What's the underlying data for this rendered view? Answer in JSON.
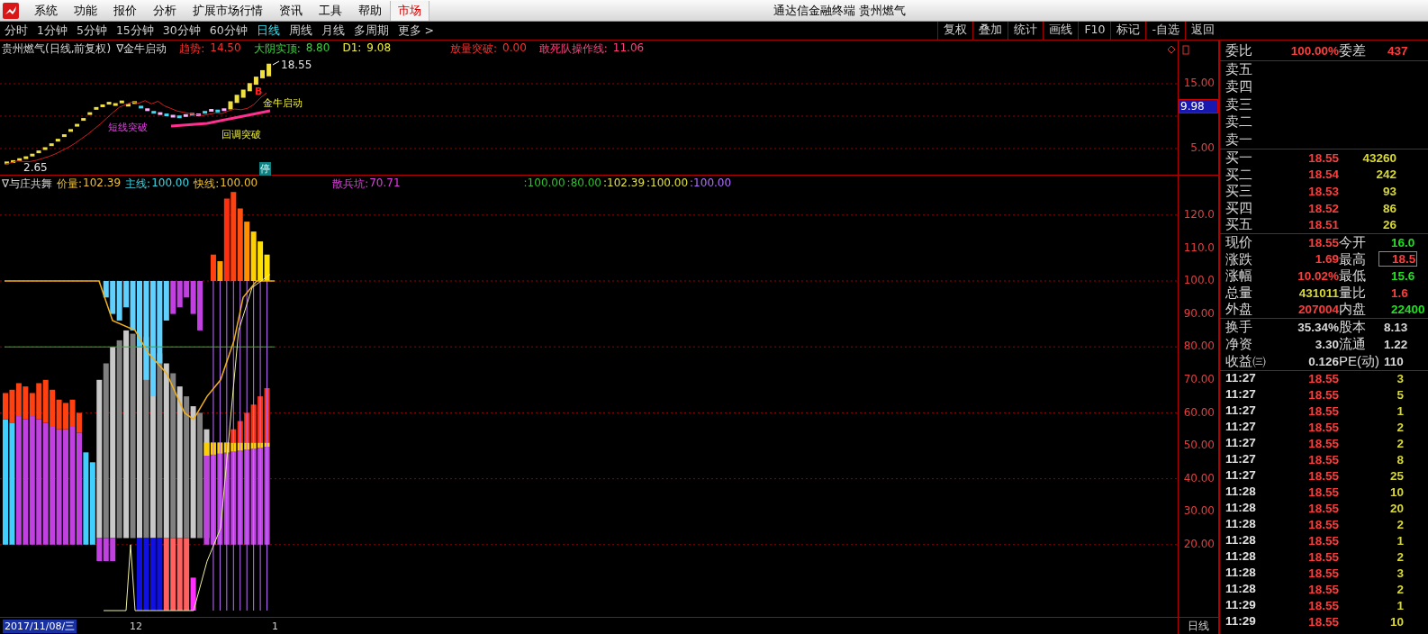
{
  "window": {
    "title": "通达信金融终端 贵州燃气"
  },
  "menu": [
    {
      "label": "系统"
    },
    {
      "label": "功能"
    },
    {
      "label": "报价"
    },
    {
      "label": "分析"
    },
    {
      "label": "扩展市场行情"
    },
    {
      "label": "资讯"
    },
    {
      "label": "工具"
    },
    {
      "label": "帮助"
    }
  ],
  "market_button": "市场",
  "periods": [
    {
      "label": "分时",
      "selected": false
    },
    {
      "label": "1分钟",
      "selected": false
    },
    {
      "label": "5分钟",
      "selected": false
    },
    {
      "label": "15分钟",
      "selected": false
    },
    {
      "label": "30分钟",
      "selected": false
    },
    {
      "label": "60分钟",
      "selected": false
    },
    {
      "label": "日线",
      "selected": true
    },
    {
      "label": "周线",
      "selected": false
    },
    {
      "label": "月线",
      "selected": false
    },
    {
      "label": "多周期",
      "selected": false
    },
    {
      "label": "更多 >",
      "selected": false
    }
  ],
  "tools": [
    "复权",
    "叠加",
    "统计",
    "画线",
    "F10",
    "标记",
    "-自选",
    "返回"
  ],
  "main_chart": {
    "stock": "贵州燃气(日线,前复权)",
    "indicator": "∇金牛启动",
    "values": [
      {
        "label": "趋势:",
        "value": "14.50",
        "color": "#ff3030"
      },
      {
        "label": "大阴实顶:",
        "value": "8.80",
        "color": "#40d040"
      },
      {
        "label": "D1:",
        "value": "9.08",
        "color": "#f0f040"
      },
      {
        "label": "放量突破:",
        "value": "0.00",
        "color": "#ff3030"
      },
      {
        "label": "敢死队操作线:",
        "value": "11.06",
        "color": "#ff4080"
      }
    ],
    "high_label": "18.55",
    "low_label": "2.65",
    "signals": [
      "短线突破",
      "金牛启动",
      "回调突破"
    ],
    "buy_mark": "B",
    "limit_mark": "停",
    "axis": [
      "15.00",
      "5.00"
    ],
    "price_tag": "9.98"
  },
  "sub_chart": {
    "indicator": "∇与庄共舞",
    "values": [
      {
        "label": "价量:",
        "value": "102.39",
        "color": "#f0c030"
      },
      {
        "label": "主线:",
        "value": "100.00",
        "color": "#40d8e8"
      },
      {
        "label": "快线:",
        "value": "100.00",
        "color": "#f0c030"
      },
      {
        "label": "散兵坑:",
        "value": "70.71",
        "color": "#e040e0"
      }
    ],
    "outputs": [
      {
        "text": ":100.00",
        "color": "#30c030"
      },
      {
        "text": ":80.00",
        "color": "#30c030"
      },
      {
        "text": ":102.39",
        "color": "#e0e040"
      },
      {
        "text": ":100.00",
        "color": "#e0e040"
      },
      {
        "text": ":100.00",
        "color": "#b070ff"
      }
    ],
    "axis": [
      "120.0",
      "110.0",
      "100.0",
      "90.00",
      "80.00",
      "70.00",
      "60.00",
      "50.00",
      "40.00",
      "30.00",
      "20.00"
    ]
  },
  "date_axis": [
    {
      "label": "2017/11/08/三",
      "selected": true
    },
    {
      "label": "12",
      "selected": false
    },
    {
      "label": "1",
      "selected": false
    }
  ],
  "period_corner": "日线",
  "quote": {
    "ratio": [
      {
        "label": "委比",
        "value": "100.00%",
        "color": "#ff3c3c"
      },
      {
        "label": "委差",
        "value": "437",
        "color": "#ff3c3c"
      }
    ],
    "asks": [
      {
        "label": "卖五"
      },
      {
        "label": "卖四"
      },
      {
        "label": "卖三"
      },
      {
        "label": "卖二"
      },
      {
        "label": "卖一"
      }
    ],
    "bids": [
      {
        "label": "买一",
        "price": "18.55",
        "volume": "43260"
      },
      {
        "label": "买二",
        "price": "18.54",
        "volume": "242"
      },
      {
        "label": "买三",
        "price": "18.53",
        "volume": "93"
      },
      {
        "label": "买四",
        "price": "18.52",
        "volume": "86"
      },
      {
        "label": "买五",
        "price": "18.51",
        "volume": "26"
      }
    ],
    "stats": [
      {
        "label": "现价",
        "value": "18.55",
        "color": "#ff3c3c",
        "boxed": false
      },
      {
        "label": "今开",
        "value": "16.0",
        "color": "#20e020",
        "boxed": false
      },
      {
        "label": "涨跌",
        "value": "1.69",
        "color": "#ff3c3c",
        "boxed": false
      },
      {
        "label": "最高",
        "value": "18.5",
        "color": "#ff3c3c",
        "boxed": true
      },
      {
        "label": "涨幅",
        "value": "10.02%",
        "color": "#ff3c3c",
        "boxed": false
      },
      {
        "label": "最低",
        "value": "15.6",
        "color": "#20e020",
        "boxed": false
      },
      {
        "label": "总量",
        "value": "431011",
        "color": "#d8d830",
        "boxed": false
      },
      {
        "label": "量比",
        "value": "1.6",
        "color": "#ff3c3c",
        "boxed": false
      },
      {
        "label": "外盘",
        "value": "207004",
        "color": "#ff3c3c",
        "boxed": false
      },
      {
        "label": "内盘",
        "value": "22400",
        "color": "#20e020",
        "boxed": false
      }
    ],
    "info": [
      {
        "label": "换手",
        "value": "35.34%"
      },
      {
        "label": "股本",
        "value": "8.13"
      },
      {
        "label": "净资",
        "value": "3.30"
      },
      {
        "label": "流通",
        "value": "1.22"
      },
      {
        "label": "收益㈢",
        "value": "0.126"
      },
      {
        "label": "PE(动)",
        "value": "110"
      }
    ],
    "ticks": [
      {
        "time": "11:27",
        "price": "18.55",
        "volume": "3"
      },
      {
        "time": "11:27",
        "price": "18.55",
        "volume": "5"
      },
      {
        "time": "11:27",
        "price": "18.55",
        "volume": "1"
      },
      {
        "time": "11:27",
        "price": "18.55",
        "volume": "2"
      },
      {
        "time": "11:27",
        "price": "18.55",
        "volume": "2"
      },
      {
        "time": "11:27",
        "price": "18.55",
        "volume": "8"
      },
      {
        "time": "11:27",
        "price": "18.55",
        "volume": "25"
      },
      {
        "time": "11:28",
        "price": "18.55",
        "volume": "10"
      },
      {
        "time": "11:28",
        "price": "18.55",
        "volume": "20"
      },
      {
        "time": "11:28",
        "price": "18.55",
        "volume": "2"
      },
      {
        "time": "11:28",
        "price": "18.55",
        "volume": "1"
      },
      {
        "time": "11:28",
        "price": "18.55",
        "volume": "2"
      },
      {
        "time": "11:28",
        "price": "18.55",
        "volume": "3"
      },
      {
        "time": "11:28",
        "price": "18.55",
        "volume": "2"
      },
      {
        "time": "11:29",
        "price": "18.55",
        "volume": "1"
      },
      {
        "time": "11:29",
        "price": "18.55",
        "volume": "10"
      }
    ]
  }
}
